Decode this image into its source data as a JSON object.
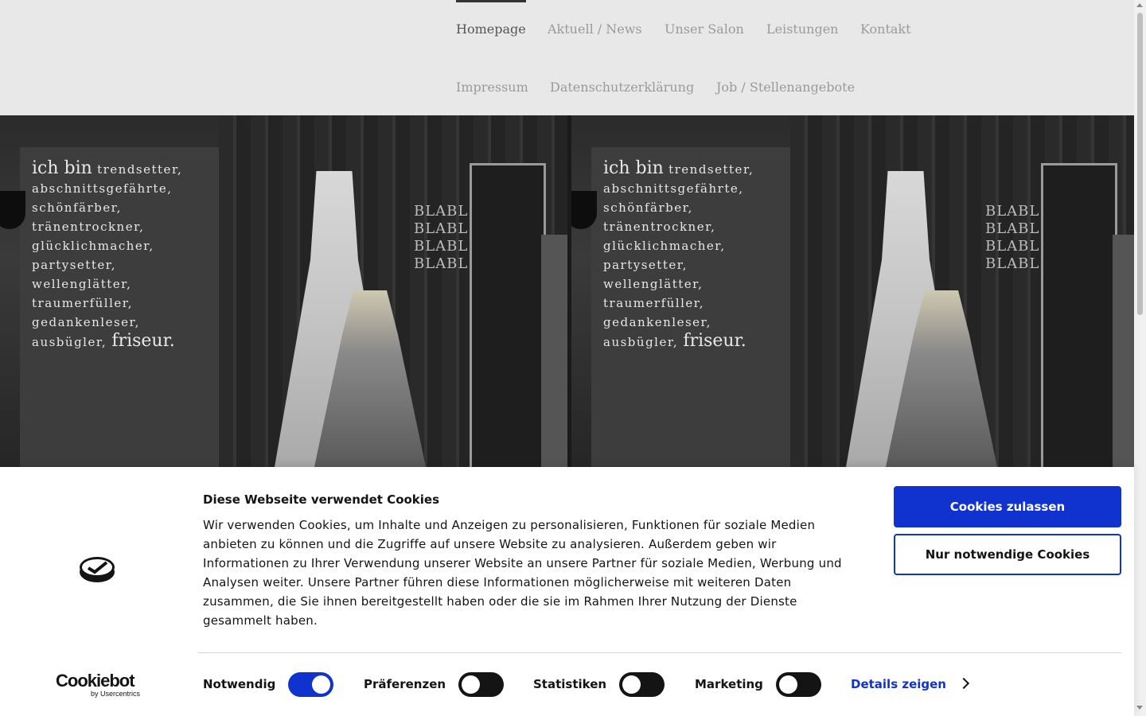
{
  "nav": {
    "items": [
      {
        "label": "Homepage",
        "active": true
      },
      {
        "label": "Aktuell / News"
      },
      {
        "label": "Unser Salon"
      },
      {
        "label": "Leistungen"
      },
      {
        "label": "Kontakt"
      },
      {
        "label": "Impressum"
      },
      {
        "label": "Datenschutzerklärung"
      },
      {
        "label": "Job / Stellenangebote"
      }
    ]
  },
  "hero": {
    "wall_text": {
      "line1_big": "ich bin",
      "line1_rest": "trendsetter,",
      "line2": "abschnittsgefährte,",
      "line3": "schönfärber, tränentrockner,",
      "line4": "glücklichmacher,",
      "line5": "partysetter, wellenglätter,",
      "line6": "traumerfüller, gedankenleser,",
      "line7": "ausbügler,",
      "line7_big": "friseur."
    },
    "chalkboard": "BLABL BLABL BLABL BLABL"
  },
  "cookie": {
    "title": "Diese Webseite verwendet Cookies",
    "text": "Wir verwenden Cookies, um Inhalte und Anzeigen zu personalisieren, Funktionen für soziale Medien anbieten zu können und die Zugriffe auf unsere Website zu analysieren. Außerdem geben wir Informationen zu Ihrer Verwendung unserer Website an unsere Partner für soziale Medien, Werbung und Analysen weiter. Unsere Partner führen diese Informationen möglicherweise mit weiteren Daten zusammen, die Sie ihnen bereitgestellt haben oder die sie im Rahmen Ihrer Nutzung der Dienste gesammelt haben.",
    "allow_label": "Cookies zulassen",
    "necessary_label": "Nur notwendige Cookies",
    "brand_name": "Cookiebot",
    "brand_sub": "by Usercentrics",
    "toggles": [
      {
        "label": "Notwendig",
        "on": true
      },
      {
        "label": "Präferenzen",
        "on": false
      },
      {
        "label": "Statistiken",
        "on": false
      },
      {
        "label": "Marketing",
        "on": false
      }
    ],
    "details_label": "Details zeigen",
    "accent_color": "#1032cf"
  }
}
